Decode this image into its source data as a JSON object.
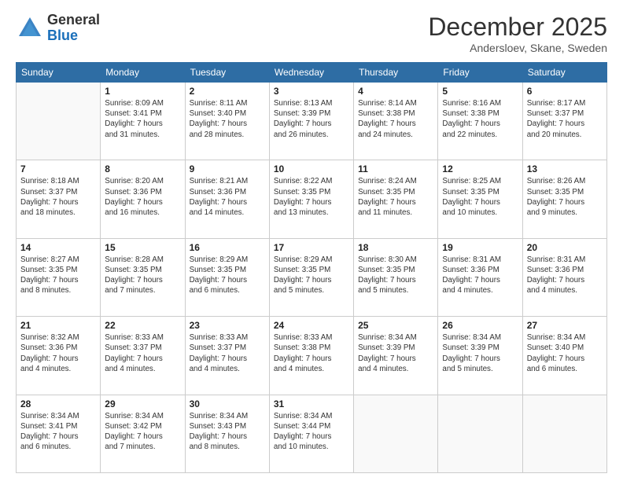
{
  "header": {
    "logo_general": "General",
    "logo_blue": "Blue",
    "month_title": "December 2025",
    "location": "Andersloev, Skane, Sweden"
  },
  "days_of_week": [
    "Sunday",
    "Monday",
    "Tuesday",
    "Wednesday",
    "Thursday",
    "Friday",
    "Saturday"
  ],
  "weeks": [
    [
      {
        "day": "",
        "info": ""
      },
      {
        "day": "1",
        "info": "Sunrise: 8:09 AM\nSunset: 3:41 PM\nDaylight: 7 hours\nand 31 minutes."
      },
      {
        "day": "2",
        "info": "Sunrise: 8:11 AM\nSunset: 3:40 PM\nDaylight: 7 hours\nand 28 minutes."
      },
      {
        "day": "3",
        "info": "Sunrise: 8:13 AM\nSunset: 3:39 PM\nDaylight: 7 hours\nand 26 minutes."
      },
      {
        "day": "4",
        "info": "Sunrise: 8:14 AM\nSunset: 3:38 PM\nDaylight: 7 hours\nand 24 minutes."
      },
      {
        "day": "5",
        "info": "Sunrise: 8:16 AM\nSunset: 3:38 PM\nDaylight: 7 hours\nand 22 minutes."
      },
      {
        "day": "6",
        "info": "Sunrise: 8:17 AM\nSunset: 3:37 PM\nDaylight: 7 hours\nand 20 minutes."
      }
    ],
    [
      {
        "day": "7",
        "info": "Sunrise: 8:18 AM\nSunset: 3:37 PM\nDaylight: 7 hours\nand 18 minutes."
      },
      {
        "day": "8",
        "info": "Sunrise: 8:20 AM\nSunset: 3:36 PM\nDaylight: 7 hours\nand 16 minutes."
      },
      {
        "day": "9",
        "info": "Sunrise: 8:21 AM\nSunset: 3:36 PM\nDaylight: 7 hours\nand 14 minutes."
      },
      {
        "day": "10",
        "info": "Sunrise: 8:22 AM\nSunset: 3:35 PM\nDaylight: 7 hours\nand 13 minutes."
      },
      {
        "day": "11",
        "info": "Sunrise: 8:24 AM\nSunset: 3:35 PM\nDaylight: 7 hours\nand 11 minutes."
      },
      {
        "day": "12",
        "info": "Sunrise: 8:25 AM\nSunset: 3:35 PM\nDaylight: 7 hours\nand 10 minutes."
      },
      {
        "day": "13",
        "info": "Sunrise: 8:26 AM\nSunset: 3:35 PM\nDaylight: 7 hours\nand 9 minutes."
      }
    ],
    [
      {
        "day": "14",
        "info": "Sunrise: 8:27 AM\nSunset: 3:35 PM\nDaylight: 7 hours\nand 8 minutes."
      },
      {
        "day": "15",
        "info": "Sunrise: 8:28 AM\nSunset: 3:35 PM\nDaylight: 7 hours\nand 7 minutes."
      },
      {
        "day": "16",
        "info": "Sunrise: 8:29 AM\nSunset: 3:35 PM\nDaylight: 7 hours\nand 6 minutes."
      },
      {
        "day": "17",
        "info": "Sunrise: 8:29 AM\nSunset: 3:35 PM\nDaylight: 7 hours\nand 5 minutes."
      },
      {
        "day": "18",
        "info": "Sunrise: 8:30 AM\nSunset: 3:35 PM\nDaylight: 7 hours\nand 5 minutes."
      },
      {
        "day": "19",
        "info": "Sunrise: 8:31 AM\nSunset: 3:36 PM\nDaylight: 7 hours\nand 4 minutes."
      },
      {
        "day": "20",
        "info": "Sunrise: 8:31 AM\nSunset: 3:36 PM\nDaylight: 7 hours\nand 4 minutes."
      }
    ],
    [
      {
        "day": "21",
        "info": "Sunrise: 8:32 AM\nSunset: 3:36 PM\nDaylight: 7 hours\nand 4 minutes."
      },
      {
        "day": "22",
        "info": "Sunrise: 8:33 AM\nSunset: 3:37 PM\nDaylight: 7 hours\nand 4 minutes."
      },
      {
        "day": "23",
        "info": "Sunrise: 8:33 AM\nSunset: 3:37 PM\nDaylight: 7 hours\nand 4 minutes."
      },
      {
        "day": "24",
        "info": "Sunrise: 8:33 AM\nSunset: 3:38 PM\nDaylight: 7 hours\nand 4 minutes."
      },
      {
        "day": "25",
        "info": "Sunrise: 8:34 AM\nSunset: 3:39 PM\nDaylight: 7 hours\nand 4 minutes."
      },
      {
        "day": "26",
        "info": "Sunrise: 8:34 AM\nSunset: 3:39 PM\nDaylight: 7 hours\nand 5 minutes."
      },
      {
        "day": "27",
        "info": "Sunrise: 8:34 AM\nSunset: 3:40 PM\nDaylight: 7 hours\nand 6 minutes."
      }
    ],
    [
      {
        "day": "28",
        "info": "Sunrise: 8:34 AM\nSunset: 3:41 PM\nDaylight: 7 hours\nand 6 minutes."
      },
      {
        "day": "29",
        "info": "Sunrise: 8:34 AM\nSunset: 3:42 PM\nDaylight: 7 hours\nand 7 minutes."
      },
      {
        "day": "30",
        "info": "Sunrise: 8:34 AM\nSunset: 3:43 PM\nDaylight: 7 hours\nand 8 minutes."
      },
      {
        "day": "31",
        "info": "Sunrise: 8:34 AM\nSunset: 3:44 PM\nDaylight: 7 hours\nand 10 minutes."
      },
      {
        "day": "",
        "info": ""
      },
      {
        "day": "",
        "info": ""
      },
      {
        "day": "",
        "info": ""
      }
    ]
  ]
}
